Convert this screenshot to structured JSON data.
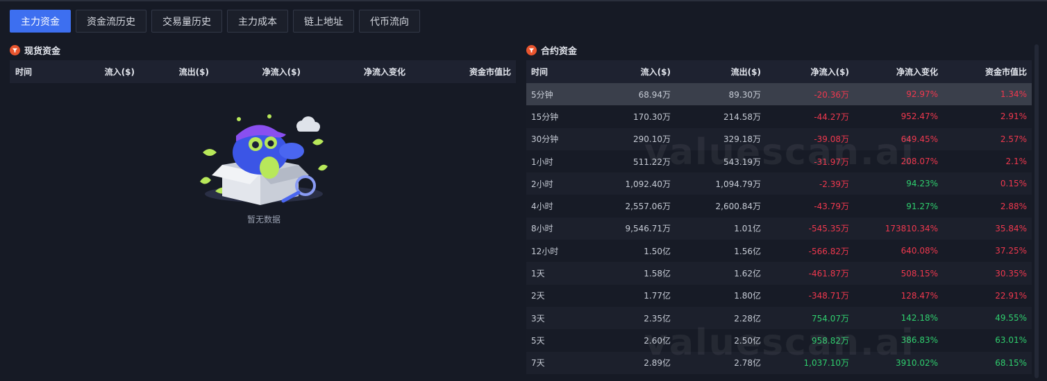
{
  "tabs": [
    {
      "label": "主力资金",
      "active": true
    },
    {
      "label": "资金流历史",
      "active": false
    },
    {
      "label": "交易量历史",
      "active": false
    },
    {
      "label": "主力成本",
      "active": false
    },
    {
      "label": "链上地址",
      "active": false
    },
    {
      "label": "代币流向",
      "active": false
    }
  ],
  "spot": {
    "title": "现货资金",
    "headers": [
      "时间",
      "流入($)",
      "流出($)",
      "净流入($)",
      "净流入变化",
      "资金市值比"
    ],
    "empty_text": "暂无数据"
  },
  "futures": {
    "title": "合约资金",
    "headers": [
      "时间",
      "流入($)",
      "流出($)",
      "净流入($)",
      "净流入变化",
      "资金市值比"
    ],
    "rows": [
      {
        "time": "5分钟",
        "inflow": "68.94万",
        "outflow": "89.30万",
        "net": "-20.36万",
        "change": "92.97%",
        "ratio": "1.34%",
        "net_c": "red",
        "change_c": "red",
        "ratio_c": "red"
      },
      {
        "time": "15分钟",
        "inflow": "170.30万",
        "outflow": "214.58万",
        "net": "-44.27万",
        "change": "952.47%",
        "ratio": "2.91%",
        "net_c": "red",
        "change_c": "red",
        "ratio_c": "red"
      },
      {
        "time": "30分钟",
        "inflow": "290.10万",
        "outflow": "329.18万",
        "net": "-39.08万",
        "change": "649.45%",
        "ratio": "2.57%",
        "net_c": "red",
        "change_c": "red",
        "ratio_c": "red"
      },
      {
        "time": "1小时",
        "inflow": "511.22万",
        "outflow": "543.19万",
        "net": "-31.97万",
        "change": "208.07%",
        "ratio": "2.1%",
        "net_c": "red",
        "change_c": "red",
        "ratio_c": "red"
      },
      {
        "time": "2小时",
        "inflow": "1,092.40万",
        "outflow": "1,094.79万",
        "net": "-2.39万",
        "change": "94.23%",
        "ratio": "0.15%",
        "net_c": "red",
        "change_c": "green",
        "ratio_c": "red"
      },
      {
        "time": "4小时",
        "inflow": "2,557.06万",
        "outflow": "2,600.84万",
        "net": "-43.79万",
        "change": "91.27%",
        "ratio": "2.88%",
        "net_c": "red",
        "change_c": "green",
        "ratio_c": "red"
      },
      {
        "time": "8小时",
        "inflow": "9,546.71万",
        "outflow": "1.01亿",
        "net": "-545.35万",
        "change": "173810.34%",
        "ratio": "35.84%",
        "net_c": "red",
        "change_c": "red",
        "ratio_c": "red"
      },
      {
        "time": "12小时",
        "inflow": "1.50亿",
        "outflow": "1.56亿",
        "net": "-566.82万",
        "change": "640.08%",
        "ratio": "37.25%",
        "net_c": "red",
        "change_c": "red",
        "ratio_c": "red"
      },
      {
        "time": "1天",
        "inflow": "1.58亿",
        "outflow": "1.62亿",
        "net": "-461.87万",
        "change": "508.15%",
        "ratio": "30.35%",
        "net_c": "red",
        "change_c": "red",
        "ratio_c": "red"
      },
      {
        "time": "2天",
        "inflow": "1.77亿",
        "outflow": "1.80亿",
        "net": "-348.71万",
        "change": "128.47%",
        "ratio": "22.91%",
        "net_c": "red",
        "change_c": "red",
        "ratio_c": "red"
      },
      {
        "time": "3天",
        "inflow": "2.35亿",
        "outflow": "2.28亿",
        "net": "754.07万",
        "change": "142.18%",
        "ratio": "49.55%",
        "net_c": "green",
        "change_c": "green",
        "ratio_c": "green"
      },
      {
        "time": "5天",
        "inflow": "2.60亿",
        "outflow": "2.50亿",
        "net": "958.82万",
        "change": "386.83%",
        "ratio": "63.01%",
        "net_c": "green",
        "change_c": "green",
        "ratio_c": "green"
      },
      {
        "time": "7天",
        "inflow": "2.89亿",
        "outflow": "2.78亿",
        "net": "1,037.10万",
        "change": "3910.02%",
        "ratio": "68.15%",
        "net_c": "green",
        "change_c": "green",
        "ratio_c": "green"
      }
    ]
  },
  "watermark": "valuescan.ai",
  "colors": {
    "accent": "#3d6ff0",
    "up": "#2fcf6e",
    "down": "#f0384e"
  }
}
